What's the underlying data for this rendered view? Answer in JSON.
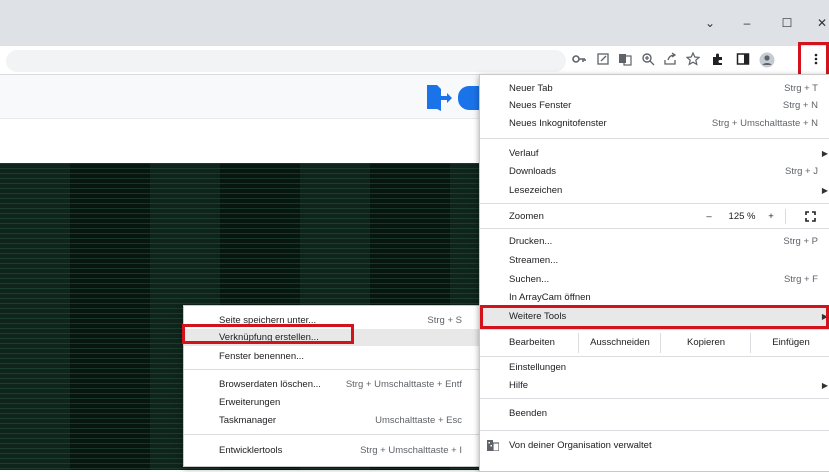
{
  "window": {
    "minimize_glyph": "–",
    "maximize_glyph": "☐",
    "close_glyph": "✕",
    "tabstrip_glyph": "⌄"
  },
  "toolbar_icons": [
    "key-icon",
    "edit-icon",
    "translate-icon",
    "zoom-icon",
    "share-icon",
    "star-icon",
    "extensions-icon",
    "sidepanel-icon",
    "profile-icon",
    "menu-icon"
  ],
  "main_menu": {
    "new_tab": {
      "label": "Neuer Tab",
      "shortcut": "Strg + T"
    },
    "new_window": {
      "label": "Neues Fenster",
      "shortcut": "Strg + N"
    },
    "incognito": {
      "label": "Neues Inkognitofenster",
      "shortcut": "Strg + Umschalttaste + N"
    },
    "history": {
      "label": "Verlauf"
    },
    "downloads": {
      "label": "Downloads",
      "shortcut": "Strg + J"
    },
    "bookmarks": {
      "label": "Lesezeichen"
    },
    "zoom": {
      "label": "Zoomen",
      "minus": "–",
      "value": "125 %",
      "plus": "+"
    },
    "print": {
      "label": "Drucken...",
      "shortcut": "Strg + P"
    },
    "cast": {
      "label": "Streamen..."
    },
    "find": {
      "label": "Suchen...",
      "shortcut": "Strg + F"
    },
    "arraycam": {
      "label": "In ArrayCam öffnen"
    },
    "more_tools": {
      "label": "Weitere Tools"
    },
    "edit": {
      "label": "Bearbeiten",
      "cut": "Ausschneiden",
      "copy": "Kopieren",
      "paste": "Einfügen"
    },
    "settings": {
      "label": "Einstellungen"
    },
    "help": {
      "label": "Hilfe"
    },
    "exit": {
      "label": "Beenden"
    },
    "managed": {
      "label": "Von deiner Organisation verwaltet"
    }
  },
  "sub_menu": {
    "save_page": {
      "label": "Seite speichern unter...",
      "shortcut": "Strg + S"
    },
    "create_shortcut": {
      "label": "Verknüpfung erstellen..."
    },
    "name_window": {
      "label": "Fenster benennen..."
    },
    "clear_data": {
      "label": "Browserdaten löschen...",
      "shortcut": "Strg + Umschalttaste + Entf"
    },
    "extensions": {
      "label": "Erweiterungen"
    },
    "task_manager": {
      "label": "Taskmanager",
      "shortcut": "Umschalttaste + Esc"
    },
    "devtools": {
      "label": "Entwicklertools",
      "shortcut": "Strg + Umschalttaste + I"
    }
  },
  "colors": {
    "highlight_red": "#d3121c",
    "page_dark": "#07170f",
    "logo_blue": "#1a73e8"
  }
}
